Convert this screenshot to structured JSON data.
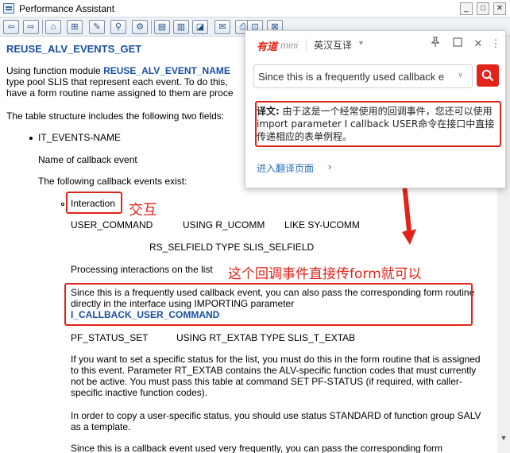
{
  "window": {
    "title": "Performance Assistant",
    "controls": {
      "minimize": "_",
      "maximize": "□",
      "close": "✕"
    }
  },
  "toolbar": {
    "buttons": [
      {
        "name": "back",
        "glyph": "⇦"
      },
      {
        "name": "forward",
        "glyph": "⇨"
      },
      {
        "name": "home",
        "glyph": "⌂"
      },
      {
        "name": "structure",
        "glyph": "⊞"
      },
      {
        "name": "edit",
        "glyph": "✎"
      },
      {
        "name": "search",
        "glyph": "⚲"
      },
      {
        "name": "settings",
        "glyph": "⚙"
      },
      {
        "name": "view1",
        "glyph": "▤"
      },
      {
        "name": "view2",
        "glyph": "▥"
      },
      {
        "name": "view3",
        "glyph": "◪"
      },
      {
        "name": "note",
        "glyph": "✉"
      },
      {
        "name": "print",
        "glyph": "⎙"
      },
      {
        "name": "bookmark",
        "glyph": "⊡"
      },
      {
        "name": "close-doc",
        "glyph": "⊠"
      }
    ]
  },
  "doc": {
    "heading": "REUSE_ALV_EVENTS_GET",
    "intro_l1a": "Using function module ",
    "intro_l1b": "REUSE_ALV_EVENT_NAME",
    "intro_l2": "type pool SLIS that represent each event. To do this,",
    "intro_l3": "have a form routine name assigned to them are proce",
    "table_text": "The table structure includes the following two fields:",
    "field1": "IT_EVENTS-NAME",
    "field1_desc": "Name of callback event",
    "events_intro": "The following callback events exist:",
    "interaction": "Interaction",
    "user_command": "USER_COMMAND",
    "using_ucomm": "USING R_UCOMM",
    "like_ucomm": "LIKE SY-UCOMM",
    "rs_selfield": "RS_SELFIELD TYPE SLIS_SELFIELD",
    "processing": "Processing interactions on the list",
    "since_para": "Since this is a frequently used callback event, you can also pass the corresponding form routine directly in the interface using IMPORTING parameter",
    "since_param": "I_CALLBACK_USER_COMMAND",
    "pf_status": "PF_STATUS_SET",
    "pf_using": "USING RT_EXTAB TYPE SLIS_T_EXTAB",
    "pf_para": "If you want to set a specific status for the list, you must do this in the form routine that is assigned to this event. Parameter RT_EXTAB contains the ALV-specific function codes that must currently not be active. You must pass this table at command SET PF-STATUS (if required, with caller-specific inactive function codes).",
    "copy_para": "In order to copy a user-specific status, you should use status STANDARD of function group SALV as a template.",
    "last_line": "Since this is a callback event used very frequently, you can pass the corresponding form"
  },
  "annotations": {
    "interaction_note": "交互",
    "processing_note": "这个回调事件直接传form就可以"
  },
  "translator": {
    "brand": "有道",
    "brand_suffix": "mini",
    "language": "英汉互译",
    "query": "Since this is a frequently used callback e",
    "result_label": "译文:",
    "result_text": "由于这是一个经常使用的回调事件，您还可以使用import parameter I callback USER命令在接口中直接传递相应的表单例程。",
    "more_link": "进入翻译页面"
  },
  "colors": {
    "accent_red": "#e2231a",
    "doc_blue": "#1a4fa0",
    "link_blue": "#2b6fb8"
  },
  "icons": [
    "app-icon",
    "pin-icon",
    "restore-icon",
    "close-icon",
    "more-icon",
    "search-icon",
    "chevron-down-icon",
    "chevron-right-icon",
    "arrow-icon"
  ]
}
